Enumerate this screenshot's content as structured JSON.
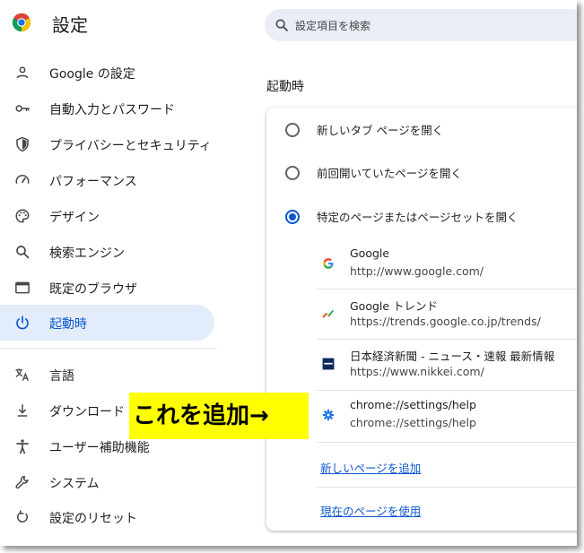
{
  "app": {
    "title": "設定"
  },
  "search": {
    "placeholder": "設定項目を検索"
  },
  "sidebar": {
    "items": [
      {
        "label": "Google の設定",
        "icon": "person-icon"
      },
      {
        "label": "自動入力とパスワード",
        "icon": "key-icon"
      },
      {
        "label": "プライバシーとセキュリティ",
        "icon": "shield-icon"
      },
      {
        "label": "パフォーマンス",
        "icon": "speedometer-icon"
      },
      {
        "label": "デザイン",
        "icon": "palette-icon"
      },
      {
        "label": "検索エンジン",
        "icon": "search-icon"
      },
      {
        "label": "既定のブラウザ",
        "icon": "browser-window-icon"
      },
      {
        "label": "起動時",
        "icon": "power-icon",
        "active": true
      },
      {
        "label": "言語",
        "icon": "translate-icon"
      },
      {
        "label": "ダウンロード",
        "icon": "download-icon"
      },
      {
        "label": "ユーザー補助機能",
        "icon": "accessibility-icon"
      },
      {
        "label": "システム",
        "icon": "wrench-icon"
      },
      {
        "label": "設定のリセット",
        "icon": "reset-icon"
      }
    ]
  },
  "main": {
    "section_title": "起動時",
    "options": [
      {
        "label": "新しいタブ ページを開く",
        "selected": false
      },
      {
        "label": "前回開いていたページを開く",
        "selected": false
      },
      {
        "label": "特定のページまたはページセットを開く",
        "selected": true
      }
    ],
    "pages": [
      {
        "name": "Google",
        "url": "http://www.google.com/",
        "icon": "google-favicon"
      },
      {
        "name": "Google トレンド",
        "url": "https://trends.google.co.jp/trends/",
        "icon": "google-trends-favicon"
      },
      {
        "name": "日本経済新聞 - ニュース・速報 最新情報",
        "url": "https://www.nikkei.com/",
        "icon": "nikkei-favicon"
      },
      {
        "name": "chrome://settings/help",
        "url": "chrome://settings/help",
        "icon": "gear-icon"
      }
    ],
    "add_page_link": "新しいページを追加",
    "use_current_link": "現在のページを使用"
  },
  "annotation": {
    "text": "これを追加→"
  },
  "colors": {
    "accent": "#0b57d0",
    "active_bg": "#e3ecfb",
    "search_bg": "#e9eef6",
    "callout_bg": "#ffff00"
  }
}
